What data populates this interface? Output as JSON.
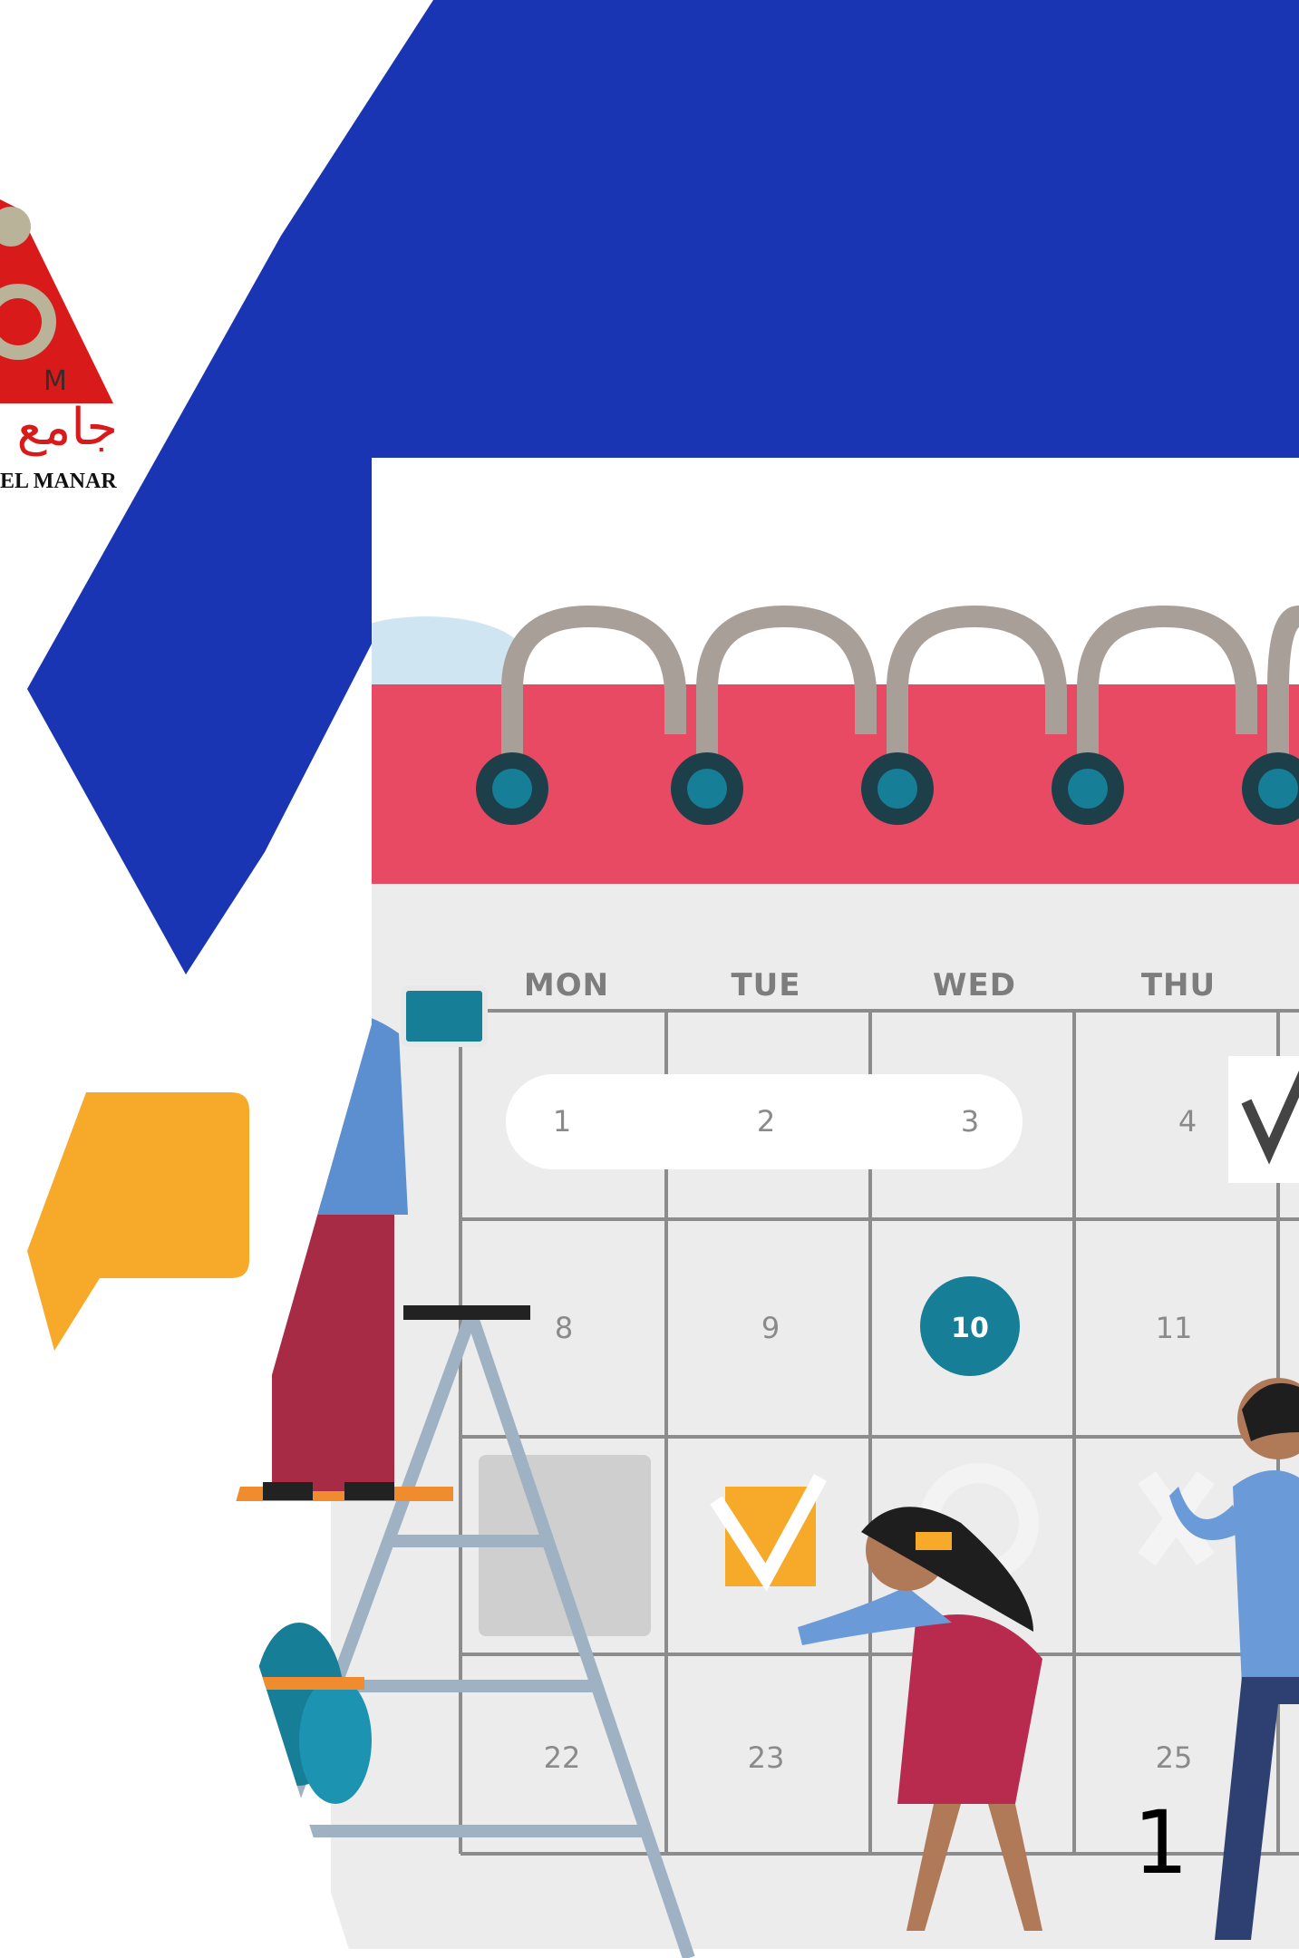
{
  "slide": {
    "page_number": "1",
    "colors": {
      "blue": "#1a35b3",
      "coral": "#e84a63",
      "orange": "#f7a92a",
      "teal": "#177e98",
      "logo_red": "#d91a1a"
    }
  },
  "logo": {
    "arabic_text": "جامع",
    "latin_text": "EL MANAR",
    "letter": "M"
  },
  "calendar": {
    "day_headers": [
      "MON",
      "TUE",
      "WED",
      "THU"
    ],
    "row1": [
      "1",
      "2",
      "3",
      "4"
    ],
    "row2": [
      "8",
      "9",
      "10",
      "11"
    ],
    "row4": [
      "22",
      "23",
      "25"
    ],
    "highlighted_day": "10"
  },
  "icons": {
    "check_mark": "check-icon",
    "orange_check": "orange-check-icon",
    "speech_bubble": "speech-bubble-icon"
  }
}
